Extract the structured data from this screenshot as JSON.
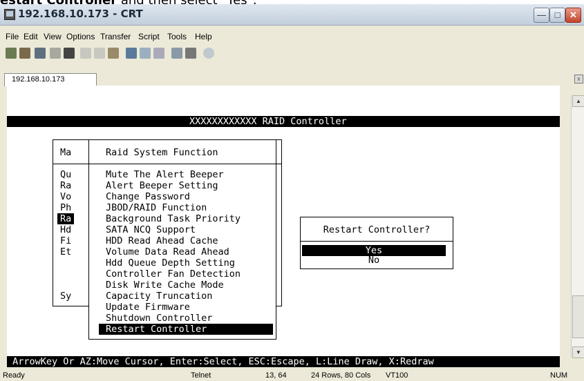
{
  "caption": {
    "bold_text": "estart Controller",
    "rest_text": " and then select \"Yes\"."
  },
  "window": {
    "title": "192.168.10.173 - CRT"
  },
  "menu": [
    "File",
    "Edit",
    "View",
    "Options",
    "Transfer",
    "Script",
    "Tools",
    "Help"
  ],
  "toolbar_icons": [
    "connect-icon",
    "quick-connect-icon",
    "new-tab-icon",
    "reconnect-icon",
    "disconnect-icon",
    "copy-icon",
    "paste-icon",
    "find-icon",
    "print-setup-icon",
    "print-icon",
    "print-screen-icon",
    "session-options-icon",
    "global-options-icon",
    "help-icon"
  ],
  "tab": {
    "label": "192.168.10.173"
  },
  "terminal": {
    "top_bar": "XXXXXXXXXXXX RAID Controller",
    "main_menu": {
      "title": "Ma",
      "items": [
        "Qu",
        "Ra",
        "Vo",
        "Ph",
        "Ra",
        "Hd",
        "Fi",
        "Et"
      ],
      "footer": "Sy"
    },
    "raid_menu": {
      "title": "Raid System Function",
      "items": [
        "Mute The Alert Beeper",
        "Alert Beeper Setting",
        "Change Password",
        "JBOD/RAID Function",
        "Background Task Priority",
        "SATA NCQ Support",
        "HDD Read Ahead Cache",
        "Volume Data Read Ahead",
        "Hdd Queue Depth Setting",
        "Controller Fan Detection",
        "Disk Write Cache Mode",
        "Capacity Truncation",
        "Update Firmware",
        "Shutdown Controller",
        "Restart Controller"
      ]
    },
    "dialog": {
      "title": "Restart Controller?",
      "options": [
        "Yes",
        "No"
      ]
    },
    "bottom_bar": " ArrowKey Or AZ:Move Cursor, Enter:Select, ESC:Escape, L:Line Draw, X:Redraw"
  },
  "status": {
    "ready": "Ready",
    "protocol": "Telnet",
    "position": "13, 64",
    "size": "24 Rows, 80 Cols",
    "emulation": "VT100",
    "num": "NUM"
  }
}
